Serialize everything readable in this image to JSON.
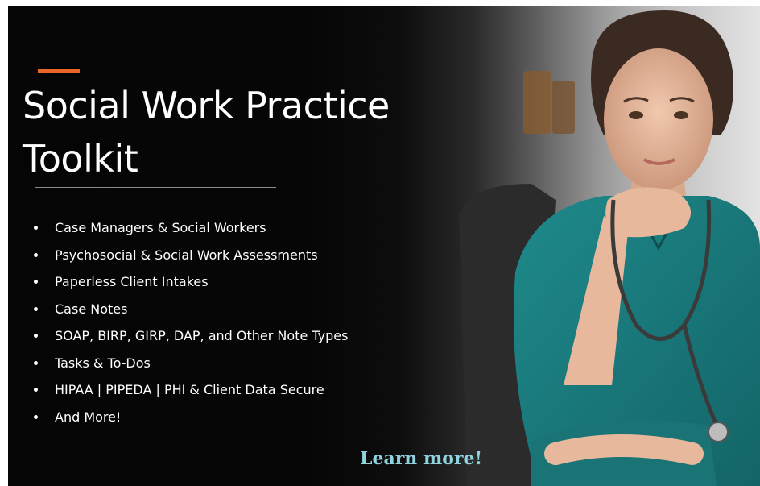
{
  "banner": {
    "title_line1": "Social Work Practice",
    "title_line2": "Toolkit",
    "features": [
      "Case Managers & Social Workers",
      "Psychosocial & Social Work Assessments",
      "Paperless Client Intakes",
      "Case Notes",
      "SOAP, BIRP, GIRP, DAP, and Other Note Types",
      "Tasks & To-Dos",
      "HIPAA | PIPEDA | PHI & Client Data Secure",
      "And More!"
    ],
    "cta": "Learn more!"
  },
  "colors": {
    "accent": "#e8652a",
    "cta": "#8fd3df",
    "scrubs": "#1f8a8c",
    "background": "#050505"
  },
  "image": {
    "subject": "healthcare-worker-photo",
    "icons": [
      "stethoscope-icon"
    ]
  }
}
